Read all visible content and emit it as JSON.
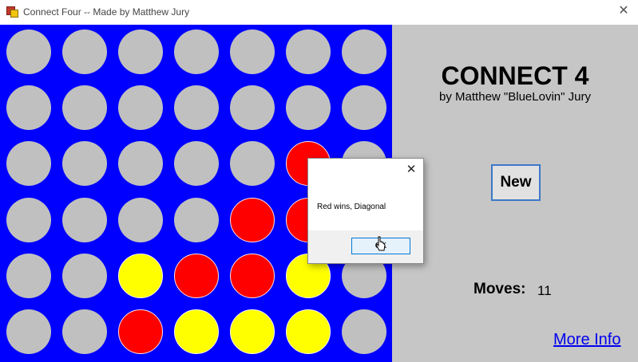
{
  "window": {
    "title": "Connect Four -- Made by Matthew Jury",
    "close_glyph": "✕"
  },
  "board": {
    "rows": [
      [
        "empty",
        "empty",
        "empty",
        "empty",
        "empty",
        "empty",
        "empty"
      ],
      [
        "empty",
        "empty",
        "empty",
        "empty",
        "empty",
        "empty",
        "empty"
      ],
      [
        "empty",
        "empty",
        "empty",
        "empty",
        "empty",
        "red",
        "empty"
      ],
      [
        "empty",
        "empty",
        "empty",
        "empty",
        "red",
        "red",
        "empty"
      ],
      [
        "empty",
        "empty",
        "yellow",
        "red",
        "red",
        "yellow",
        "empty"
      ],
      [
        "empty",
        "empty",
        "red",
        "yellow",
        "yellow",
        "yellow",
        "empty"
      ]
    ],
    "colors": {
      "board": "#0000ff",
      "empty": "#c0c0c0",
      "red": "#ff0000",
      "yellow": "#ffff00"
    }
  },
  "side": {
    "title": "CONNECT 4",
    "byline": "by Matthew \"BlueLovin\" Jury",
    "new_button": "New",
    "moves_label": "Moves:",
    "moves_value": "11",
    "more_info": "More Info"
  },
  "dialog": {
    "message": "Red wins, Diagonal",
    "ok_label": "OK",
    "close_glyph": "✕"
  }
}
